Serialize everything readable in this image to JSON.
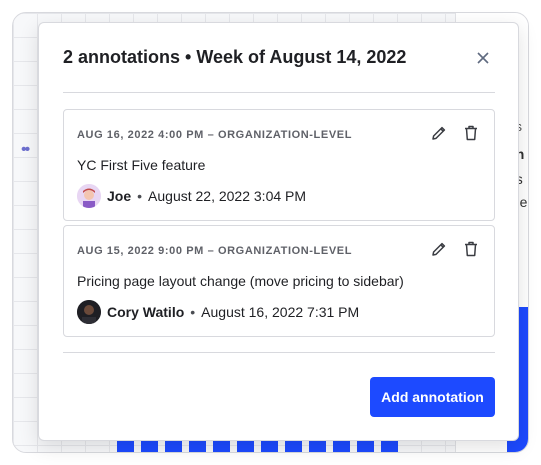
{
  "background": {
    "right_panel_lines": [
      "DS",
      "an",
      "es",
      "me"
    ]
  },
  "popover": {
    "title": "2 annotations • Week of August 14, 2022",
    "close_icon": "close-icon",
    "annotations": [
      {
        "meta": "AUG 16, 2022 4:00 PM – ORGANIZATION-LEVEL",
        "text": "YC First Five feature",
        "author": "Joe",
        "separator": "•",
        "timestamp": "August 22, 2022 3:04 PM",
        "avatar": "joe-avatar"
      },
      {
        "meta": "AUG 15, 2022 9:00 PM – ORGANIZATION-LEVEL",
        "text": "Pricing page layout change (move pricing to sidebar)",
        "author": "Cory Watilo",
        "separator": "•",
        "timestamp": "August 16, 2022 7:31 PM",
        "avatar": "cory-avatar"
      }
    ],
    "add_button_label": "Add annotation"
  },
  "colors": {
    "accent": "#1d4aff",
    "border": "#d8d9de",
    "text": "#1f2024",
    "muted": "#5f6168"
  }
}
